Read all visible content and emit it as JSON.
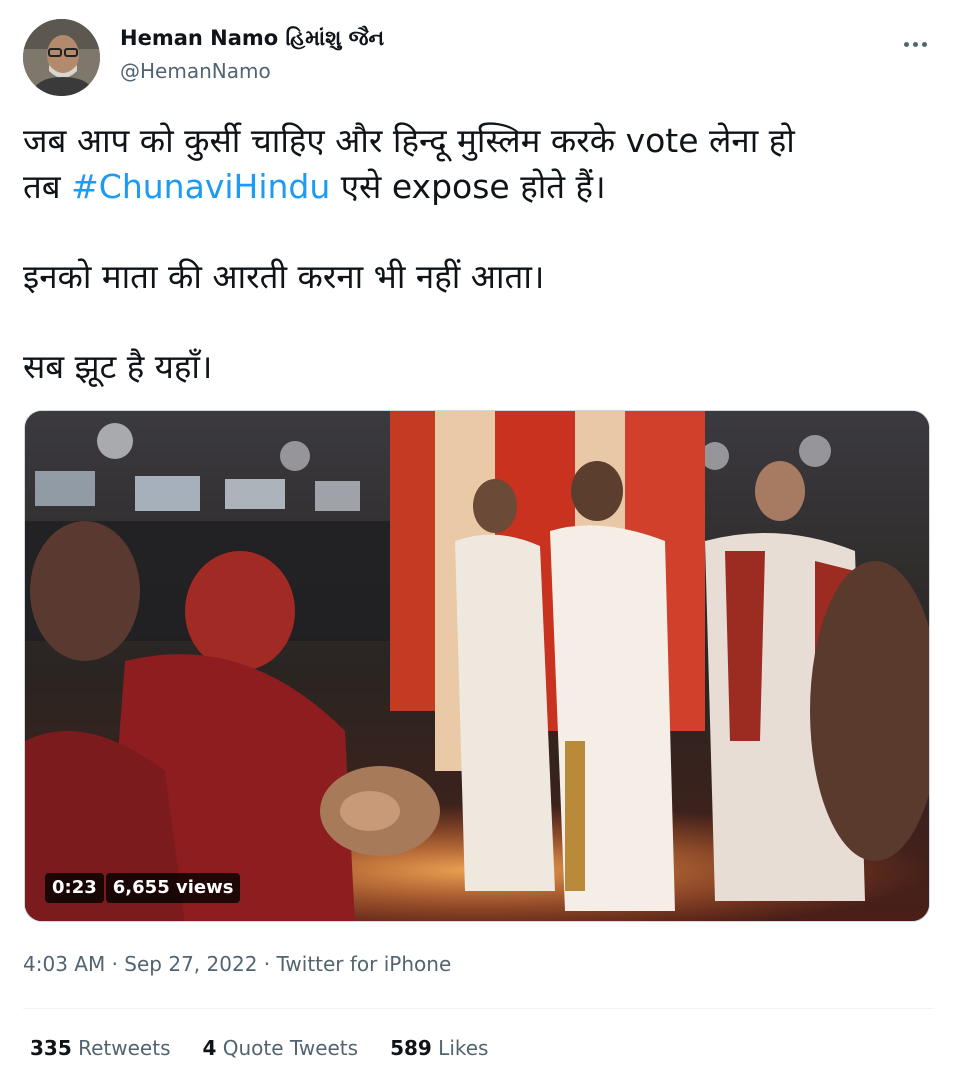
{
  "author": {
    "name": "Heman Namo હિમાંશુ જૈન",
    "handle": "@HemanNamo"
  },
  "tweet": {
    "line1_before": "जब आप को कुर्सी चाहिए और हिन्दू मुस्लिम करके vote लेना हो",
    "line2_prefix": "तब ",
    "hashtag": "#ChunaviHindu",
    "line2_suffix": " एसे expose होते हैं।",
    "paragraph2": "इनको माता की आरती करना भी नहीं आता।",
    "paragraph3": "सब झूट है यहाँ।"
  },
  "video": {
    "duration": "0:23",
    "views": "6,655 views"
  },
  "meta": {
    "time": "4:03 AM",
    "separator": " · ",
    "date": "Sep 27, 2022",
    "source": "Twitter for iPhone"
  },
  "stats": {
    "retweets_count": "335",
    "retweets_label": "Retweets",
    "quotes_count": "4",
    "quotes_label": "Quote Tweets",
    "likes_count": "589",
    "likes_label": "Likes"
  },
  "icons": {
    "more": "more-horizontal-icon"
  }
}
